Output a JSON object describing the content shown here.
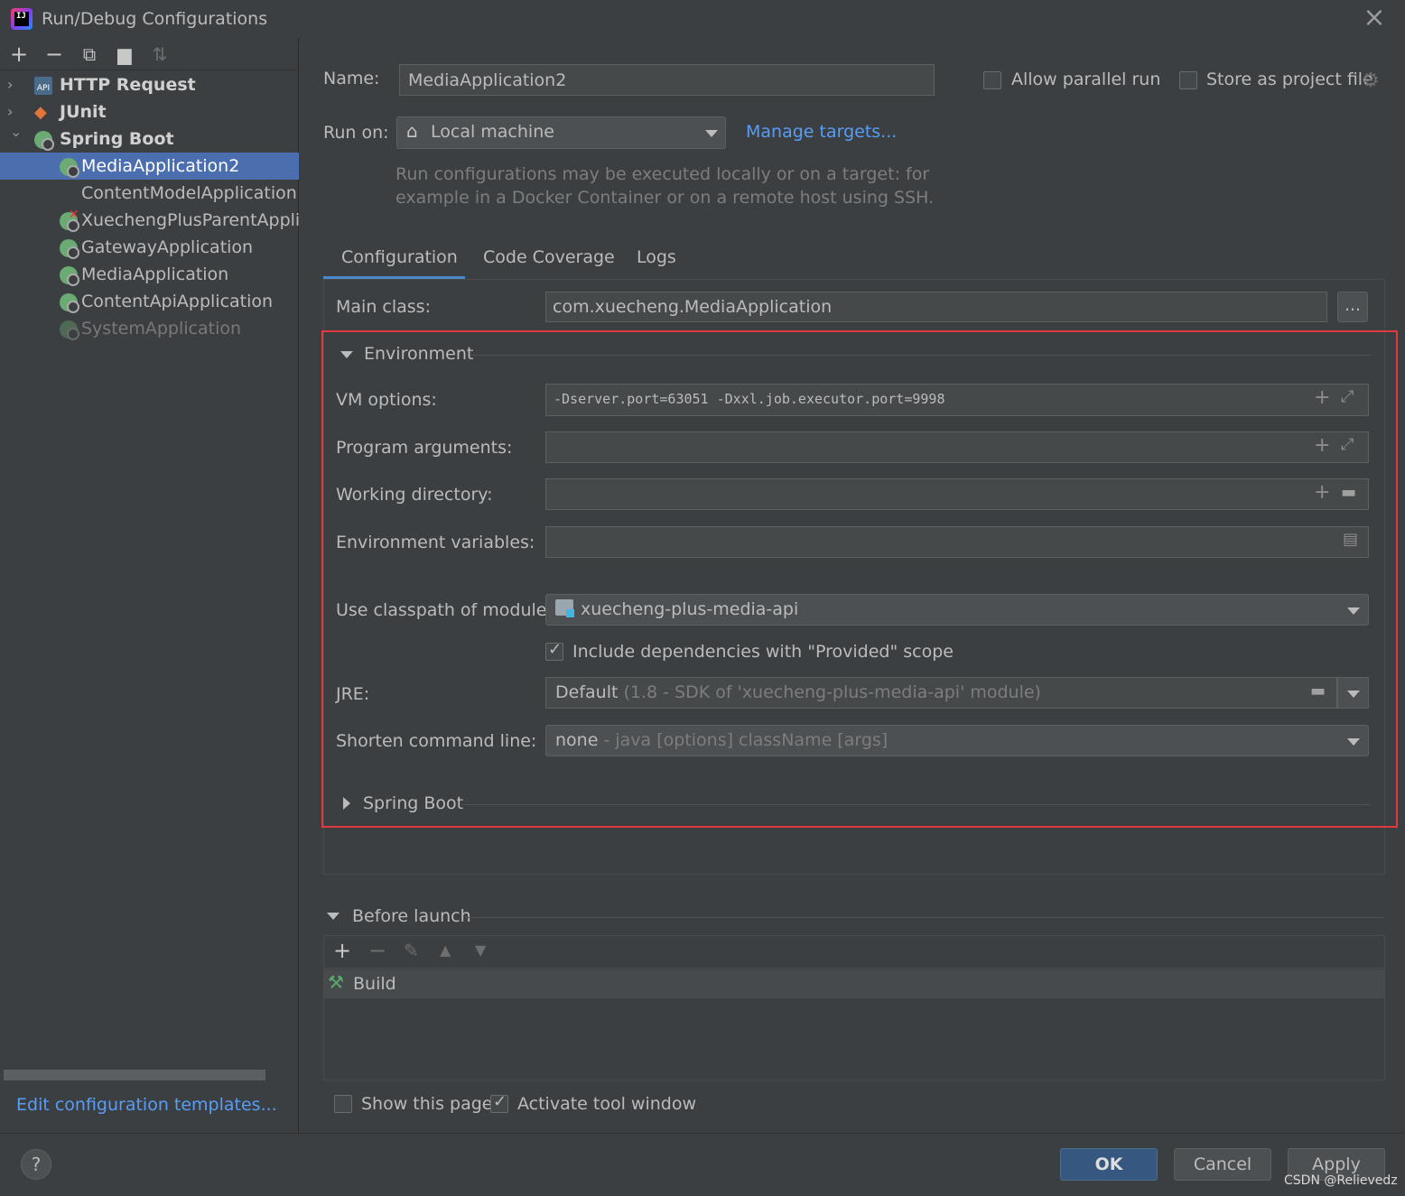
{
  "window": {
    "title": "Run/Debug Configurations"
  },
  "sidebar": {
    "toolbar": [
      "add-icon",
      "remove-icon",
      "copy-icon",
      "new-folder-icon",
      "sort-icon"
    ],
    "tree": [
      {
        "label": "HTTP Request",
        "bold": true,
        "expanded": false
      },
      {
        "label": "JUnit",
        "bold": true,
        "expanded": false
      },
      {
        "label": "Spring Boot",
        "bold": true,
        "expanded": true
      },
      {
        "label": "MediaApplication2",
        "selected": true
      },
      {
        "label": "ContentModelApplication"
      },
      {
        "label": "XuechengPlusParentApplica"
      },
      {
        "label": "GatewayApplication"
      },
      {
        "label": "MediaApplication"
      },
      {
        "label": "ContentApiApplication"
      },
      {
        "label": "SystemApplication",
        "disabled": true
      }
    ],
    "edit_templates": "Edit configuration templates..."
  },
  "header": {
    "name_label": "Name:",
    "name_value": "MediaApplication2",
    "allow_parallel": "Allow parallel run",
    "store_project": "Store as project file",
    "run_on_label": "Run on:",
    "run_on_value": "Local machine",
    "manage_targets": "Manage targets...",
    "hint_line1": "Run configurations may be executed locally or on a target: for",
    "hint_line2": "example in a Docker Container or on a remote host using SSH."
  },
  "tabs": [
    {
      "label": "Configuration",
      "active": true
    },
    {
      "label": "Code Coverage"
    },
    {
      "label": "Logs"
    }
  ],
  "config": {
    "main_class_label": "Main class:",
    "main_class_value": "com.xuecheng.MediaApplication",
    "browse_label": "...",
    "environment_title": "Environment",
    "vm_label": "VM options:",
    "vm_value": "-Dserver.port=63051 -Dxxl.job.executor.port=9998",
    "program_args_label": "Program arguments:",
    "working_dir_label": "Working directory:",
    "env_vars_label": "Environment variables:",
    "classpath_label": "Use classpath of module:",
    "classpath_value": "xuecheng-plus-media-api",
    "include_deps": "Include dependencies with \"Provided\" scope",
    "jre_label": "JRE:",
    "jre_value": "Default",
    "jre_hint": "(1.8 - SDK of 'xuecheng-plus-media-api' module)",
    "shorten_label": "Shorten command line:",
    "shorten_value": "none",
    "shorten_hint": "- java [options] className [args]",
    "spring_boot_section": "Spring Boot"
  },
  "before_launch": {
    "title": "Before launch",
    "items": [
      "Build"
    ]
  },
  "footer": {
    "show_page": "Show this page",
    "activate_tool": "Activate tool window",
    "ok": "OK",
    "cancel": "Cancel",
    "apply": "Apply",
    "help": "?",
    "watermark": "CSDN @Relievedz"
  }
}
